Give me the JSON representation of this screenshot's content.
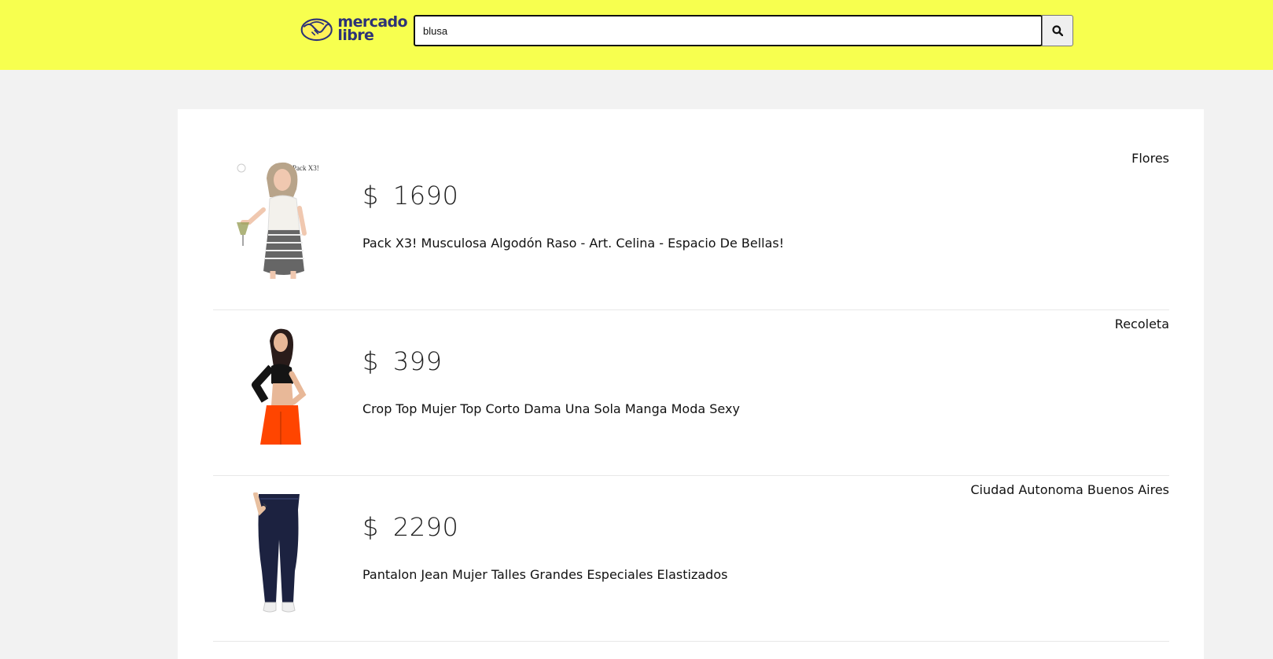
{
  "header": {
    "logo": {
      "line1": "mercado",
      "line2": "libre"
    },
    "search": {
      "value": "blusa",
      "button_icon": "search-icon"
    },
    "background_color": "#f7ff4f"
  },
  "results": [
    {
      "price_currency": "$",
      "price": "1690",
      "title": "Pack X3! Musculosa Algodón Raso - Art. Celina - Espacio De Bellas!",
      "location": "Flores",
      "image_overlay_text": "Pack X3!"
    },
    {
      "price_currency": "$",
      "price": "399",
      "title": "Crop Top Mujer Top Corto Dama Una Sola Manga Moda Sexy",
      "location": "Recoleta"
    },
    {
      "price_currency": "$",
      "price": "2290",
      "title": "Pantalon Jean Mujer Talles Grandes Especiales Elastizados",
      "location": "Ciudad Autonoma Buenos Aires"
    }
  ]
}
